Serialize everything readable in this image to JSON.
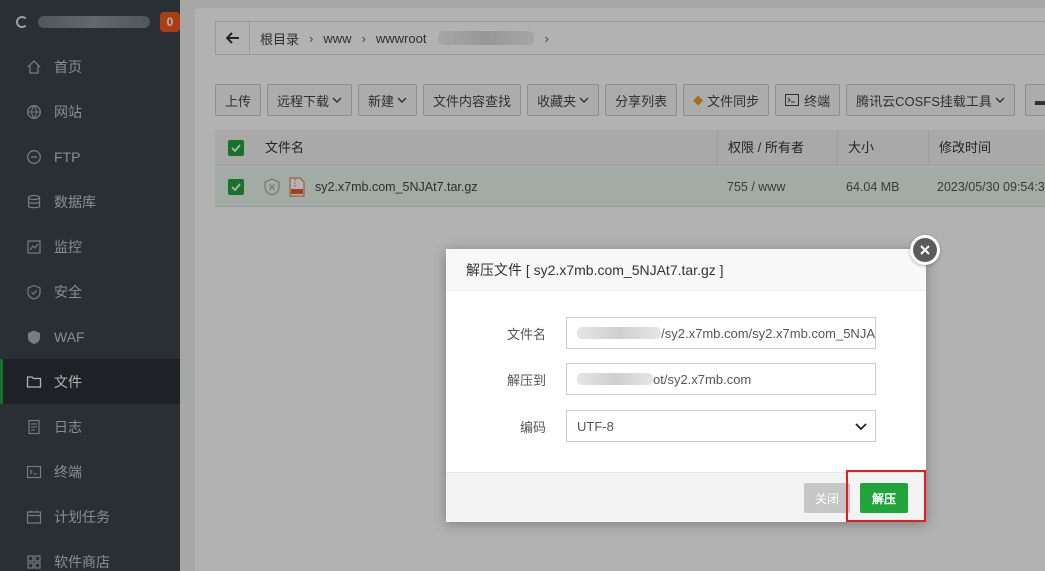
{
  "sidebar": {
    "badge": "0",
    "items": [
      {
        "label": "首页",
        "icon": "home-icon"
      },
      {
        "label": "网站",
        "icon": "globe-icon"
      },
      {
        "label": "FTP",
        "icon": "ftp-icon"
      },
      {
        "label": "数据库",
        "icon": "database-icon"
      },
      {
        "label": "监控",
        "icon": "monitor-icon"
      },
      {
        "label": "安全",
        "icon": "shield-icon"
      },
      {
        "label": "WAF",
        "icon": "waf-shield-icon"
      },
      {
        "label": "文件",
        "icon": "folder-icon"
      },
      {
        "label": "日志",
        "icon": "log-icon"
      },
      {
        "label": "终端",
        "icon": "terminal-icon"
      },
      {
        "label": "计划任务",
        "icon": "calendar-icon"
      },
      {
        "label": "软件商店",
        "icon": "store-icon"
      }
    ],
    "active_index": 7
  },
  "path": {
    "crumbs": [
      "根目录",
      "www",
      "wwwroot"
    ]
  },
  "toolbar": {
    "upload": "上传",
    "remote_download": "远程下载",
    "new": "新建",
    "content_search": "文件内容查找",
    "favorites": "收藏夹",
    "share_list": "分享列表",
    "file_sync": "文件同步",
    "terminal": "终端",
    "cosfs": "腾讯云COSFS挂载工具"
  },
  "table": {
    "headers": {
      "name": "文件名",
      "perm": "权限 / 所有者",
      "size": "大小",
      "mtime": "修改时间"
    },
    "rows": [
      {
        "name": "sy2.x7mb.com_5NJAt7.tar.gz",
        "perm": "755 / www",
        "size": "64.04 MB",
        "mtime": "2023/05/30 09:54:3"
      }
    ]
  },
  "dialog": {
    "title": "解压文件 [ sy2.x7mb.com_5NJAt7.tar.gz ]",
    "filename_label": "文件名",
    "filename_value": "/sy2.x7mb.com/sy2.x7mb.com_5NJA",
    "extract_to_label": "解压到",
    "extract_to_value": "ot/sy2.x7mb.com",
    "encoding_label": "编码",
    "encoding_value": "UTF-8",
    "close_button": "关闭",
    "extract_button": "解压"
  },
  "colors": {
    "accent": "#20a53a",
    "sidebar_bg": "#3c444d",
    "badge": "#f25a1b",
    "highlight": "#e02020"
  }
}
